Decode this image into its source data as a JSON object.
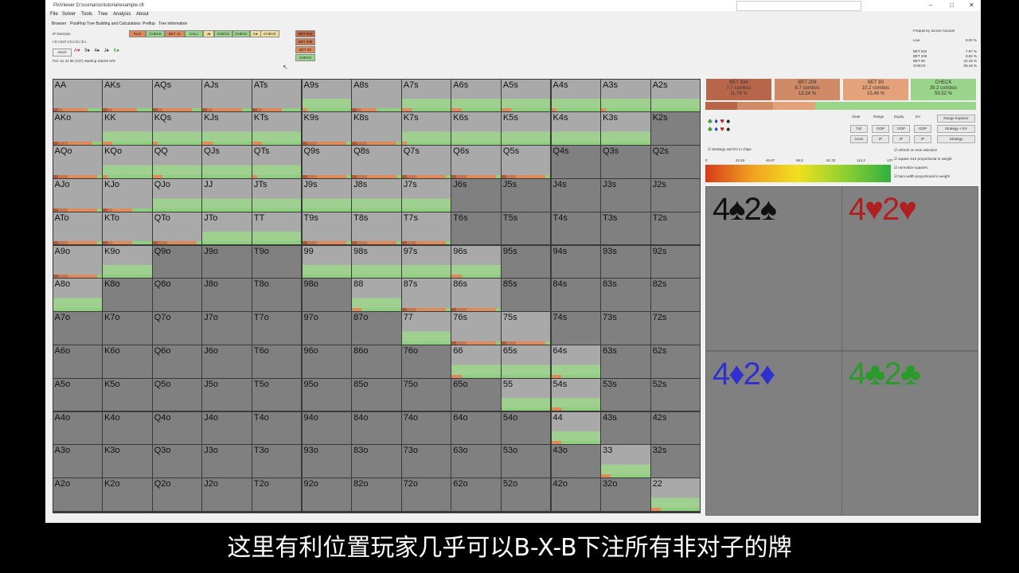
{
  "window": {
    "title": "PioViewer D:\\scenarios\\tutorial\\example.cfr",
    "minimize_icon": "minimize-icon",
    "maximize_icon": "maximize-icon",
    "close_icon": "close-icon"
  },
  "menu": [
    "File",
    "Solver",
    "Tools",
    "Tree",
    "Analysis",
    "About"
  ],
  "tabs": [
    "Browser",
    "PostFlop Tree Building and Calculations",
    "Preflop",
    "Tree information"
  ],
  "decision": {
    "title": "IP Decision",
    "line": "r:0:c:b47:c:b:c:b:c:b:c",
    "insert_label": "Insert",
    "board": [
      {
        "text": "A♥",
        "color": "#c0262c"
      },
      {
        "text": "9♠",
        "color": "#111111"
      },
      {
        "text": "4♠",
        "color": "#111111"
      },
      {
        "text": "J♠",
        "color": "#111111"
      },
      {
        "text": "K♠",
        "color": "#2f8f2f"
      }
    ],
    "pot_line": "Pot: 41 41 55 (137) Starting Stacks 975"
  },
  "actions": {
    "row1": [
      {
        "label": "Root",
        "color": "#e08a5a"
      },
      {
        "label": "CHECK",
        "color": "#9ad48a"
      },
      {
        "label": "BET 41",
        "color": "#e08a5a"
      },
      {
        "label": "CALL",
        "color": "#9ad48a"
      },
      {
        "label": "J♠",
        "color": "#f0e0a0"
      },
      {
        "label": "CHECK",
        "color": "#9ad48a"
      },
      {
        "label": "CHECK",
        "color": "#9ad48a"
      },
      {
        "label": "K♠",
        "color": "#f0e0a0"
      },
      {
        "label": "CHECK",
        "color": "#f0e0a0"
      }
    ],
    "column": [
      {
        "label": "BET 934",
        "color": "#c0684a"
      },
      {
        "label": "BET 208",
        "color": "#d07a50"
      },
      {
        "label": "BET 90",
        "color": "#e08a5a"
      },
      {
        "label": "CHECK",
        "color": "#9ad48a"
      }
    ]
  },
  "frequency": {
    "title": "Frequency across runouts",
    "line_label": "Line",
    "line_value": "8.00 %",
    "rows": [
      {
        "label": "BET 934",
        "value": "7.87 %"
      },
      {
        "label": "BET 208",
        "value": "8.82 %"
      },
      {
        "label": "BET 90",
        "value": "22.15 %"
      },
      {
        "label": "CHECK",
        "value": "59.16 %"
      }
    ]
  },
  "grid_labels": [
    [
      "AA",
      "AKs",
      "AQs",
      "AJs",
      "ATs",
      "A9s",
      "A8s",
      "A7s",
      "A6s",
      "A5s",
      "A4s",
      "A3s",
      "A2s"
    ],
    [
      "AKo",
      "KK",
      "KQs",
      "KJs",
      "KTs",
      "K9s",
      "K8s",
      "K7s",
      "K6s",
      "K5s",
      "K4s",
      "K3s",
      "K2s"
    ],
    [
      "AQo",
      "KQo",
      "QQ",
      "QJs",
      "QTs",
      "Q9s",
      "Q8s",
      "Q7s",
      "Q6s",
      "Q5s",
      "Q4s",
      "Q3s",
      "Q2s"
    ],
    [
      "AJo",
      "KJo",
      "QJo",
      "JJ",
      "JTs",
      "J9s",
      "J8s",
      "J7s",
      "J6s",
      "J5s",
      "J4s",
      "J3s",
      "J2s"
    ],
    [
      "ATo",
      "KTo",
      "QTo",
      "JTo",
      "TT",
      "T9s",
      "T8s",
      "T7s",
      "T6s",
      "T5s",
      "T4s",
      "T3s",
      "T2s"
    ],
    [
      "A9o",
      "K9o",
      "Q9o",
      "J9o",
      "T9o",
      "99",
      "98s",
      "97s",
      "96s",
      "95s",
      "94s",
      "93s",
      "92s"
    ],
    [
      "A8o",
      "K8o",
      "Q8o",
      "J8o",
      "T8o",
      "98o",
      "88",
      "87s",
      "86s",
      "85s",
      "84s",
      "83s",
      "82s"
    ],
    [
      "A7o",
      "K7o",
      "Q7o",
      "J7o",
      "T7o",
      "97o",
      "87o",
      "77",
      "76s",
      "75s",
      "74s",
      "73s",
      "72s"
    ],
    [
      "A6o",
      "K6o",
      "Q6o",
      "J6o",
      "T6o",
      "96o",
      "86o",
      "76o",
      "66",
      "65s",
      "64s",
      "63s",
      "62s"
    ],
    [
      "A5o",
      "K5o",
      "Q5o",
      "J5o",
      "T5o",
      "95o",
      "85o",
      "75o",
      "65o",
      "55",
      "54s",
      "53s",
      "52s"
    ],
    [
      "A4o",
      "K4o",
      "Q4o",
      "J4o",
      "T4o",
      "94o",
      "84o",
      "74o",
      "64o",
      "54o",
      "44",
      "43s",
      "42s"
    ],
    [
      "A3o",
      "K3o",
      "Q3o",
      "J3o",
      "T3o",
      "93o",
      "83o",
      "73o",
      "63o",
      "53o",
      "43o",
      "33",
      "32s"
    ],
    [
      "A2o",
      "K2o",
      "Q2o",
      "J2o",
      "T2o",
      "92o",
      "82o",
      "72o",
      "62o",
      "52o",
      "42o",
      "32o",
      "22"
    ]
  ],
  "grid_strategy": {
    "AA": [
      0.1,
      0.1,
      0.5,
      0.3
    ],
    "AKs": [
      0.1,
      0.1,
      0.5,
      0.3
    ],
    "AQs": [
      0.1,
      0.1,
      0.6,
      0.2
    ],
    "AJs": [
      0.1,
      0.1,
      0.6,
      0.2
    ],
    "ATs": [
      0.1,
      0.1,
      0.4,
      0.4
    ],
    "A9s": [
      0.0,
      0.0,
      0.1,
      0.9
    ],
    "A8s": [
      0.1,
      0.1,
      0.3,
      0.5
    ],
    "A7s": [
      0.0,
      0.0,
      0.2,
      0.8
    ],
    "A6s": [
      0.0,
      0.0,
      0.2,
      0.8
    ],
    "A5s": [
      0.0,
      0.0,
      0.2,
      0.8
    ],
    "A4s": [
      0.0,
      0.0,
      0.1,
      0.9
    ],
    "A3s": [
      0.0,
      0.0,
      0.1,
      0.9
    ],
    "A2s": [
      0.0,
      0.0,
      0.0,
      1.0
    ],
    "AKo": [
      0.1,
      0.2,
      0.5,
      0.2
    ],
    "KK": [
      0.0,
      0.0,
      0.2,
      0.8
    ],
    "KQs": [
      0.0,
      0.0,
      0.1,
      0.9
    ],
    "KJs": [
      0.0,
      0.0,
      0.2,
      0.8
    ],
    "KTs": [
      0.0,
      0.0,
      0.2,
      0.8
    ],
    "K9s": [
      0.1,
      0.2,
      0.6,
      0.1
    ],
    "K8s": [
      0.1,
      0.2,
      0.6,
      0.1
    ],
    "K7s": [
      0.0,
      0.0,
      0.1,
      0.9
    ],
    "K6s": [
      0.0,
      0.0,
      0.0,
      1.0
    ],
    "K5s": [
      0.0,
      0.0,
      0.0,
      1.0
    ],
    "K4s": [
      0.0,
      0.0,
      0.0,
      1.0
    ],
    "K3s": [
      0.0,
      0.0,
      0.0,
      1.0
    ],
    "AQo": [
      0.1,
      0.2,
      0.6,
      0.1
    ],
    "KQo": [
      0.0,
      0.0,
      0.1,
      0.9
    ],
    "QQ": [
      0.0,
      0.0,
      0.2,
      0.8
    ],
    "QJs": [
      0.0,
      0.0,
      0.0,
      1.0
    ],
    "QTs": [
      0.0,
      0.0,
      0.1,
      0.9
    ],
    "Q9s": [
      0.1,
      0.2,
      0.6,
      0.1
    ],
    "Q8s": [
      0.1,
      0.2,
      0.6,
      0.1
    ],
    "Q7s": [
      0.1,
      0.2,
      0.6,
      0.1
    ],
    "Q6s": [
      0.1,
      0.2,
      0.6,
      0.1
    ],
    "Q5s": [
      0.1,
      0.2,
      0.6,
      0.1
    ],
    "AJo": [
      0.1,
      0.2,
      0.6,
      0.1
    ],
    "KJo": [
      0.1,
      0.1,
      0.4,
      0.4
    ],
    "QJo": [
      0.0,
      0.0,
      0.0,
      1.0
    ],
    "JJ": [
      0.0,
      0.0,
      0.0,
      1.0
    ],
    "JTs": [
      0.0,
      0.0,
      0.0,
      1.0
    ],
    "J9s": [
      0.0,
      0.0,
      0.0,
      1.0
    ],
    "J8s": [
      0.0,
      0.0,
      0.0,
      1.0
    ],
    "J7s": [
      0.0,
      0.0,
      0.0,
      1.0
    ],
    "ATo": [
      0.1,
      0.2,
      0.6,
      0.1
    ],
    "KTo": [
      0.1,
      0.1,
      0.4,
      0.4
    ],
    "QTo": [
      0.1,
      0.2,
      0.6,
      0.1
    ],
    "JTo": [
      0.0,
      0.0,
      0.0,
      1.0
    ],
    "TT": [
      0.0,
      0.0,
      0.0,
      1.0
    ],
    "T9s": [
      0.1,
      0.2,
      0.6,
      0.1
    ],
    "T8s": [
      0.1,
      0.2,
      0.6,
      0.1
    ],
    "T7s": [
      0.1,
      0.2,
      0.6,
      0.1
    ],
    "A9o": [
      0.1,
      0.2,
      0.6,
      0.1
    ],
    "K9o": [
      0.0,
      0.0,
      0.0,
      1.0
    ],
    "99": [
      0.0,
      0.0,
      0.0,
      1.0
    ],
    "98s": [
      0.0,
      0.0,
      0.0,
      1.0
    ],
    "97s": [
      0.0,
      0.0,
      0.0,
      1.0
    ],
    "96s": [
      0.0,
      0.0,
      0.2,
      0.8
    ],
    "A8o": [
      0.0,
      0.0,
      0.0,
      1.0
    ],
    "88": [
      0.0,
      0.0,
      0.2,
      0.8
    ],
    "87s": [
      0.1,
      0.2,
      0.6,
      0.1
    ],
    "86s": [
      0.1,
      0.2,
      0.6,
      0.1
    ],
    "77": [
      0.0,
      0.0,
      0.0,
      1.0
    ],
    "76s": [
      0.1,
      0.2,
      0.6,
      0.1
    ],
    "75s": [
      0.1,
      0.2,
      0.6,
      0.1
    ],
    "66": [
      0.0,
      0.0,
      0.2,
      0.8
    ],
    "65s": [
      0.0,
      0.0,
      0.0,
      1.0
    ],
    "64s": [
      0.0,
      0.0,
      0.2,
      0.8
    ],
    "55": [
      0.0,
      0.0,
      0.0,
      1.0
    ],
    "54s": [
      0.0,
      0.0,
      0.2,
      0.8
    ],
    "44": [
      0.0,
      0.0,
      0.2,
      0.8
    ],
    "33": [
      0.0,
      0.0,
      0.2,
      0.8
    ],
    "22": [
      0.0,
      0.0,
      0.2,
      0.8
    ]
  },
  "strategy_colors": [
    "#b05a3a",
    "#c8764e",
    "#e08a5a",
    "#8fcf7f"
  ],
  "stats": [
    {
      "label": "BET 934",
      "combos": "7.7 combos",
      "pct": "11.79 %",
      "color": "#b8664a"
    },
    {
      "label": "BET 208",
      "combos": "8.7 combos",
      "pct": "13.24 %",
      "color": "#cf8a66"
    },
    {
      "label": "BET 90",
      "combos": "10.2 combos",
      "pct": "15.46 %",
      "color": "#e4a27a"
    },
    {
      "label": "CHECK",
      "combos": "39.2 combos",
      "pct": "59.52 %",
      "color": "#9ad48a"
    }
  ],
  "stratbar": [
    0.1179,
    0.1324,
    0.1546,
    0.5952
  ],
  "controls": {
    "headers": [
      "Clear",
      "Range",
      "Equity",
      "EV"
    ],
    "row1": [
      "full",
      "OOP",
      "OOP",
      "OOP"
    ],
    "row2": [
      "zoom",
      "IP",
      "IP",
      "IP"
    ],
    "right_buttons": [
      "Range Explorer",
      "Strategy + EV",
      "Strategy"
    ],
    "strategy_check": "Strategy and EV in chips",
    "checkboxes": [
      "refresh on new selection",
      "square size proportional to weight",
      "normalize squares",
      "bars width proportional to weight"
    ]
  },
  "gradient_ticks": [
    "0",
    "22.83",
    "45.67",
    "68.5",
    "91.33",
    "114.2",
    "137"
  ],
  "combos": [
    {
      "text": "4♠2♠",
      "color": "#111111"
    },
    {
      "text": "4♥2♥",
      "color": "#b02020"
    },
    {
      "text": "4♦2♦",
      "color": "#3030d0"
    },
    {
      "text": "4♣2♣",
      "color": "#2a9a2a"
    }
  ],
  "subtitle": "这里有利位置玩家几乎可以B-X-B下注所有非对子的牌"
}
